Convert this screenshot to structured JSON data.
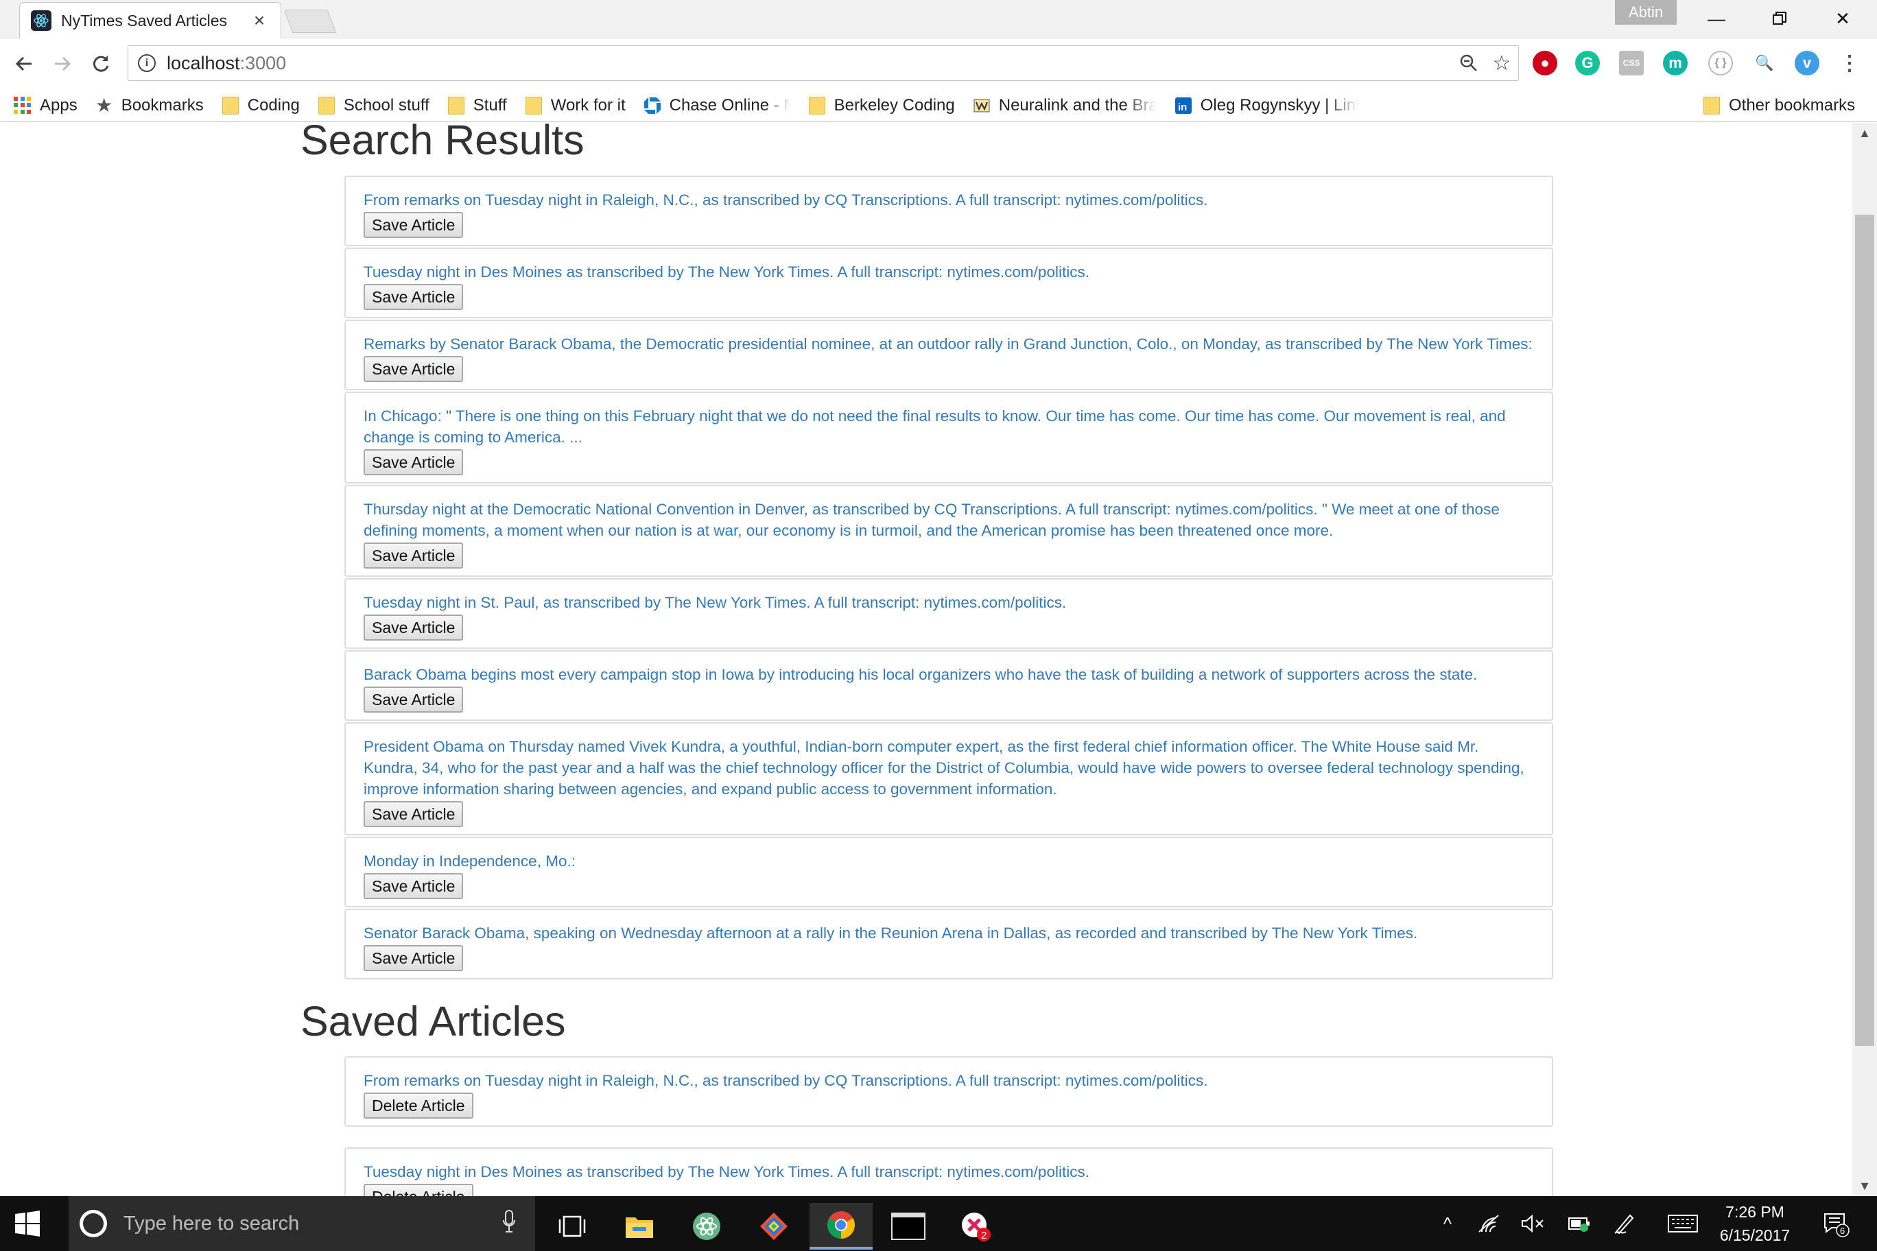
{
  "browser": {
    "tab_title": "NyTimes Saved Articles",
    "profile_name": "Abtin",
    "url_host": "localhost",
    "url_port": ":3000",
    "bookmarks": [
      {
        "label": "Apps",
        "icon": "apps-grid-icon"
      },
      {
        "label": "Bookmarks",
        "icon": "star-icon"
      },
      {
        "label": "Coding",
        "icon": "folder-icon"
      },
      {
        "label": "School stuff",
        "icon": "folder-icon"
      },
      {
        "label": "Stuff",
        "icon": "folder-icon"
      },
      {
        "label": "Work for it",
        "icon": "folder-icon"
      },
      {
        "label": "Chase Online - My Ac",
        "icon": "chase-icon"
      },
      {
        "label": "Berkeley Coding",
        "icon": "folder-icon"
      },
      {
        "label": "Neuralink and the Bra",
        "icon": "wbw-icon"
      },
      {
        "label": "Oleg Rogynskyy | Link",
        "icon": "linkedin-icon"
      }
    ],
    "other_bookmarks": "Other bookmarks"
  },
  "page": {
    "search_heading": "Search Results",
    "saved_heading": "Saved Articles",
    "save_label": "Save Article",
    "delete_label": "Delete Article",
    "search_results": [
      "From remarks on Tuesday night in Raleigh, N.C., as transcribed by CQ Transcriptions. A full transcript: nytimes.com/politics.",
      "Tuesday night in Des Moines as transcribed by The New York Times. A full transcript: nytimes.com/politics.",
      "Remarks by Senator Barack Obama, the Democratic presidential nominee, at an outdoor rally in Grand Junction, Colo., on Monday, as transcribed by The New York Times:",
      "In Chicago: \" There is one thing on this February night that we do not need the final results to know. Our time has come. Our time has come. Our movement is real, and change is coming to America. ...",
      "Thursday night at the Democratic National Convention in Denver, as transcribed by CQ Transcriptions. A full transcript: nytimes.com/politics. \" We meet at one of those defining moments, a moment when our nation is at war, our economy is in turmoil, and the American promise has been threatened once more.",
      "Tuesday night in St. Paul, as transcribed by The New York Times. A full transcript: nytimes.com/politics.",
      "Barack Obama begins most every campaign stop in Iowa by introducing his local organizers who have the task of building a network of supporters across the state.",
      "President Obama on Thursday named Vivek Kundra, a youthful, Indian-born computer expert, as the first federal chief information officer. The White House said Mr. Kundra, 34, who for the past year and a half was the chief technology officer for the District of Columbia, would have wide powers to oversee federal technology spending, improve information sharing between agencies, and expand public access to government information.",
      "Monday in Independence, Mo.:",
      "Senator Barack Obama, speaking on Wednesday afternoon at a rally in the Reunion Arena in Dallas, as recorded and transcribed by The New York Times."
    ],
    "saved_articles": [
      "From remarks on Tuesday night in Raleigh, N.C., as transcribed by CQ Transcriptions. A full transcript: nytimes.com/politics.",
      "Tuesday night in Des Moines as transcribed by The New York Times. A full transcript: nytimes.com/politics."
    ]
  },
  "taskbar": {
    "search_placeholder": "Type here to search",
    "time": "7:26 PM",
    "date": "6/15/2017",
    "notification_count": "6",
    "app_badge": "2"
  },
  "colors": {
    "link": "#337ab7",
    "heading": "#333333",
    "taskbar": "#101010"
  }
}
